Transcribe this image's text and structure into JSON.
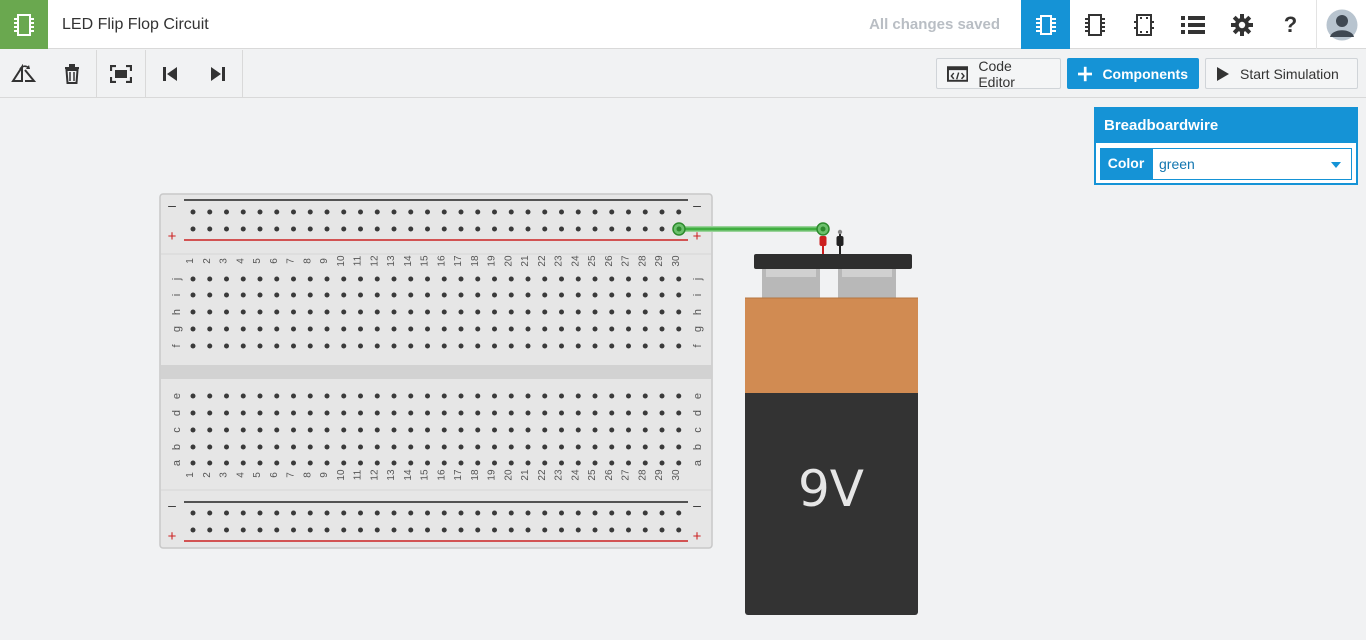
{
  "app": {
    "title": "LED Flip Flop Circuit",
    "save_status": "All changes saved",
    "accent_color": "#1593d6",
    "logo_color": "#6aa84f"
  },
  "topnav": {
    "icons": [
      "circuit-view-icon",
      "component-view-icon",
      "schematic-view-icon",
      "component-list-icon",
      "settings-icon",
      "help-icon"
    ],
    "help_glyph": "?",
    "active": "circuit-view-icon"
  },
  "toolbar": {
    "left_icons": [
      "rotate-icon",
      "delete-icon",
      "fit-view-icon",
      "step-back-icon",
      "step-forward-icon"
    ],
    "code_editor_label": "Code Editor",
    "components_label": "Components",
    "start_simulation_label": "Start Simulation"
  },
  "inspector": {
    "title": "Breadboardwire",
    "color_label": "Color",
    "color_value": "green"
  },
  "breadboard": {
    "columns": [
      "1",
      "2",
      "3",
      "4",
      "5",
      "6",
      "7",
      "8",
      "9",
      "10",
      "11",
      "12",
      "13",
      "14",
      "15",
      "16",
      "17",
      "18",
      "19",
      "20",
      "21",
      "22",
      "23",
      "24",
      "25",
      "26",
      "27",
      "28",
      "29",
      "30"
    ],
    "rows_top": [
      "j",
      "i",
      "h",
      "g",
      "f"
    ],
    "rows_bottom": [
      "e",
      "d",
      "c",
      "b",
      "a"
    ],
    "rail_minus": "–",
    "rail_plus": "+",
    "rail_plus_color": "#cc2222",
    "rail_minus_color": "#222222"
  },
  "battery": {
    "label": "9V",
    "top_color": "#d18b52",
    "body_color": "#333333"
  },
  "wire": {
    "color": "#3fae3f"
  }
}
